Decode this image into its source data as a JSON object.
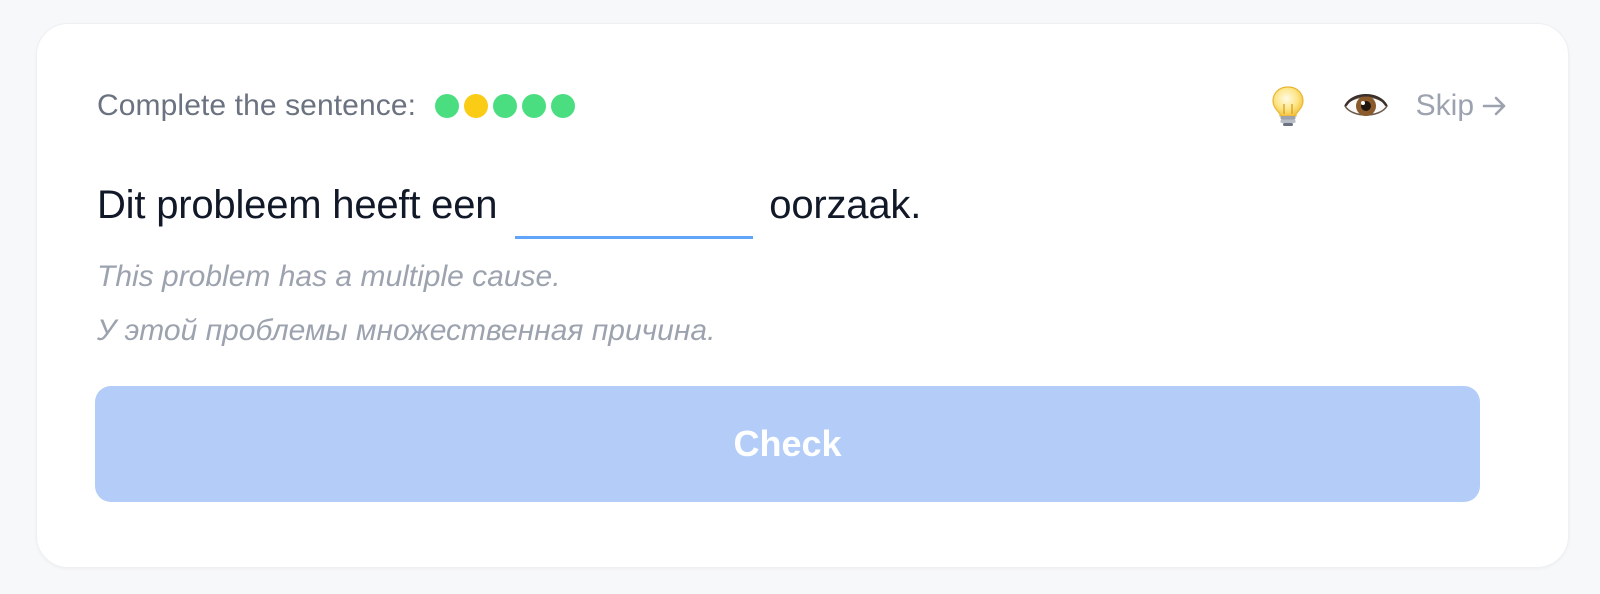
{
  "exercise": {
    "prompt_label": "Complete the sentence:",
    "progress_dots": [
      {
        "status": "correct",
        "color": "#4ade80"
      },
      {
        "status": "partial",
        "color": "#facc15"
      },
      {
        "status": "correct",
        "color": "#4ade80"
      },
      {
        "status": "correct",
        "color": "#4ade80"
      },
      {
        "status": "correct",
        "color": "#4ade80"
      }
    ],
    "sentence_before": "Dit probleem heeft een",
    "blank_value": "",
    "sentence_after": "oorzaak.",
    "translation_en": "This problem has a multiple cause.",
    "translation_ru": "У этой проблемы множественная причина."
  },
  "actions": {
    "hint_icon": "lightbulb-icon",
    "reveal_icon": "eye-icon",
    "skip_label": "Skip",
    "skip_icon": "arrow-right-icon"
  },
  "check_button": {
    "label": "Check",
    "state": "disabled"
  },
  "colors": {
    "accent": "#60a5fa",
    "button_disabled": "#b3cdf8",
    "muted_text": "#9ca3af"
  }
}
